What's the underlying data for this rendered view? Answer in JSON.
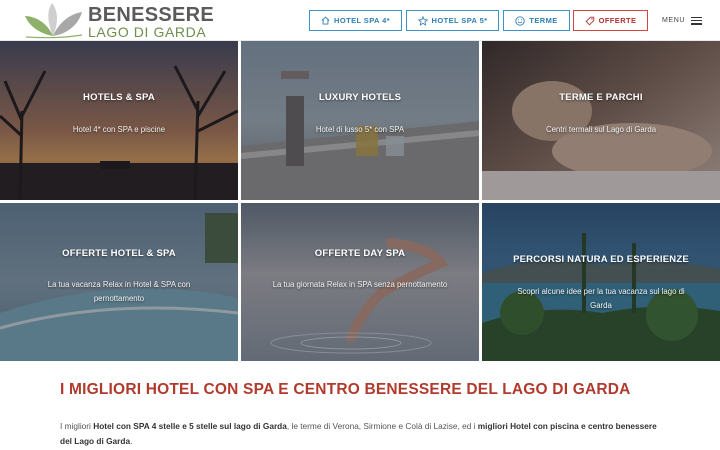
{
  "logo": {
    "line1": "BENESSERE",
    "line2": "LAGO DI GARDA",
    "brand_green": "#6f8f4e",
    "brand_gray": "#5b5b5b"
  },
  "nav": {
    "buttons": [
      {
        "label": "HOTEL SPA 4*",
        "icon": "house-icon"
      },
      {
        "label": "HOTEL SPA 5*",
        "icon": "star-icon"
      },
      {
        "label": "TERME",
        "icon": "smile-icon"
      },
      {
        "label": "OFFERTE",
        "icon": "tag-icon"
      }
    ],
    "menu_label": "MENU",
    "accent": "#3c93c6",
    "offers_accent": "#d84343"
  },
  "tiles": [
    {
      "title": "HOTELS & SPA",
      "subtitle": "Hotel 4* con SPA e piscine"
    },
    {
      "title": "LUXURY HOTELS",
      "subtitle": "Hotel di lusso 5* con SPA"
    },
    {
      "title": "TERME E PARCHI",
      "subtitle": "Centri termali sul Lago di Garda"
    },
    {
      "title": "OFFERTE HOTEL & SPA",
      "subtitle": "La tua vacanza Relax in Hotel & SPA con pernottamento"
    },
    {
      "title": "OFFERTE DAY SPA",
      "subtitle": "La tua giornata Relax in SPA senza pernottamento"
    },
    {
      "title": "PERCORSI NATURA ED ESPERIENZE",
      "subtitle": "Scopri alcune idee per la tua vacanza sul lago di Garda"
    }
  ],
  "content": {
    "headline": "I MIGLIORI HOTEL CON SPA E CENTRO BENESSERE DEL LAGO DI GARDA",
    "para": {
      "part1": "I migliori ",
      "bold1": "Hotel con SPA 4 stelle e 5 stelle sul lago di Garda",
      "part2": ", le terme di Verona, Sirmione e Colà di Lazise, ed i ",
      "bold2": "migliori Hotel con piscina e centro benessere del Lago di Garda",
      "part3": "."
    },
    "headline_color": "#b13a2d"
  }
}
